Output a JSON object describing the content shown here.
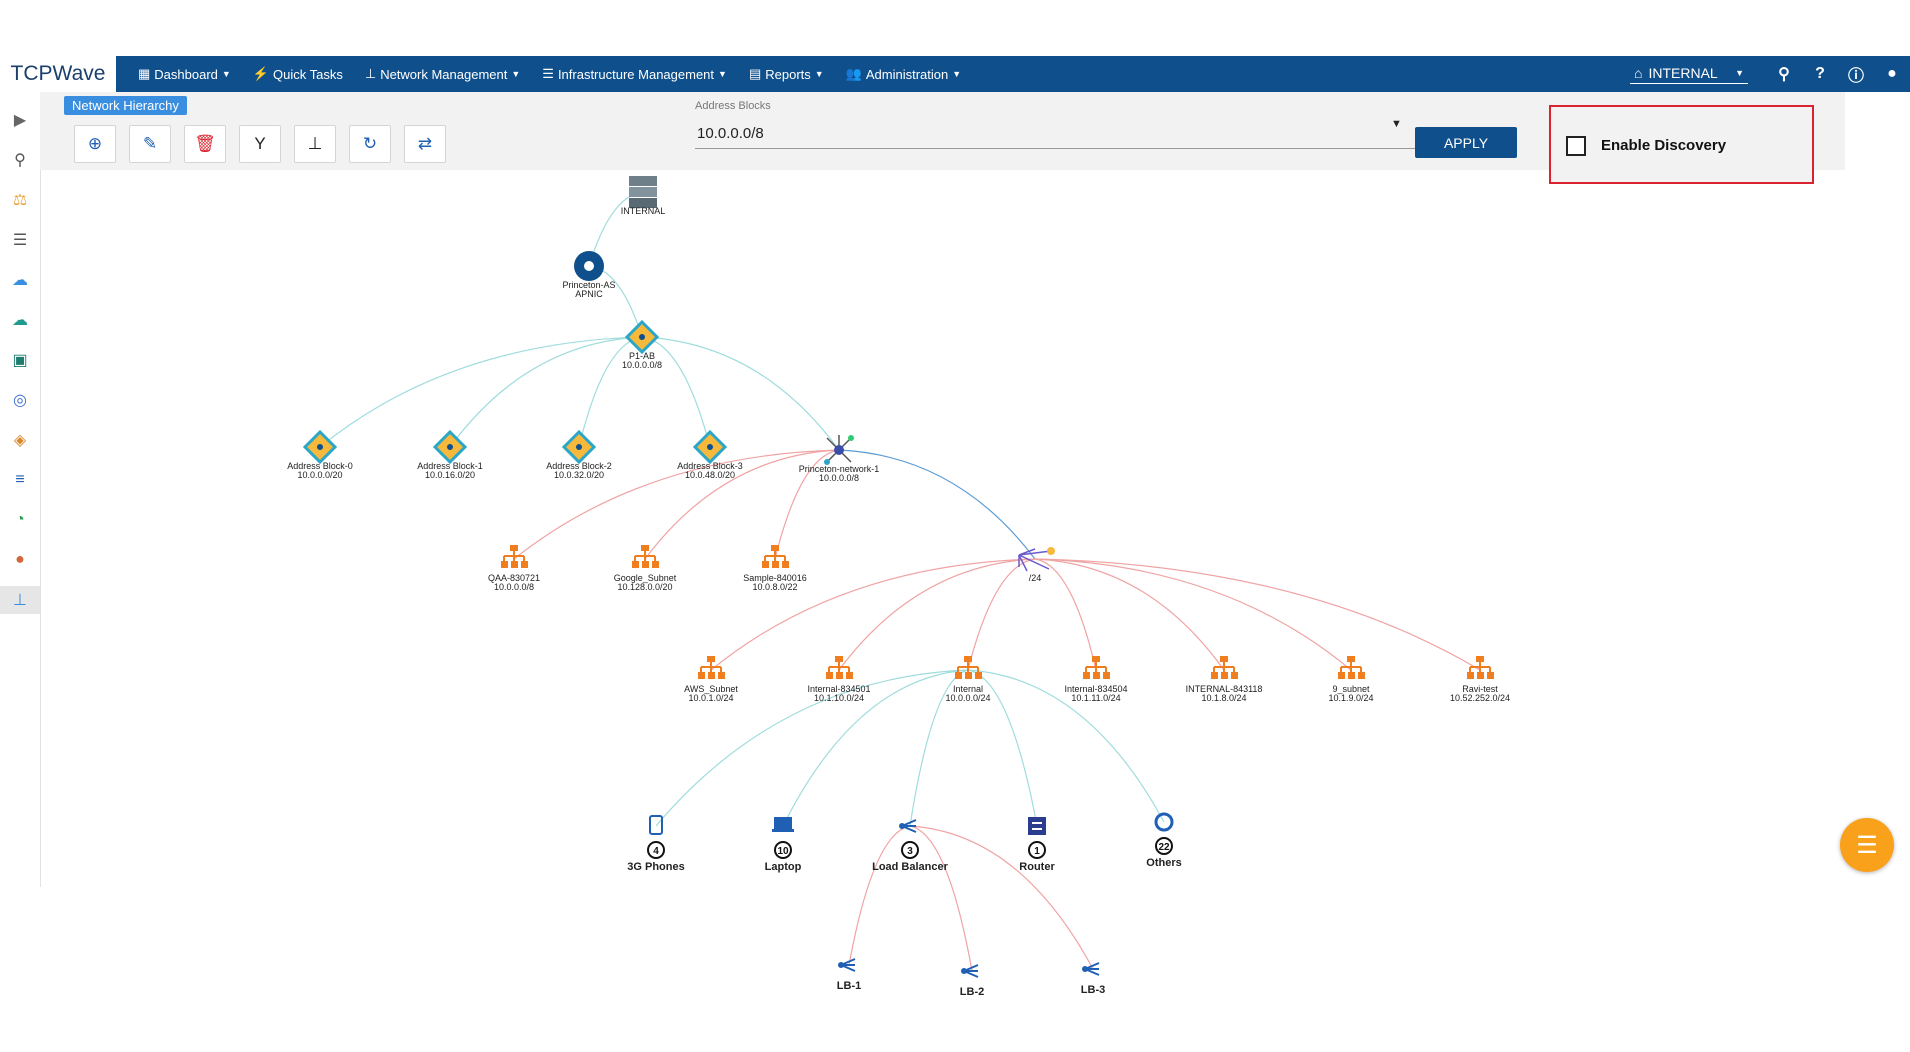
{
  "brand": {
    "logo_text": "TCPWave"
  },
  "nav": {
    "items": [
      {
        "label": "Dashboard",
        "icon": "grid-icon",
        "caret": true
      },
      {
        "label": "Quick Tasks",
        "icon": "wand-icon",
        "caret": false
      },
      {
        "label": "Network Management",
        "icon": "sitemap-icon",
        "caret": true
      },
      {
        "label": "Infrastructure Management",
        "icon": "list-icon",
        "caret": true
      },
      {
        "label": "Reports",
        "icon": "book-icon",
        "caret": true
      },
      {
        "label": "Administration",
        "icon": "users-icon",
        "caret": true
      }
    ],
    "instance": "INTERNAL",
    "right_icons": [
      "search-icon",
      "help-icon",
      "info-icon",
      "user-icon"
    ]
  },
  "sidebar": {
    "icons": [
      "expand-arrow-icon",
      "search-icon",
      "scale-icon",
      "server-stack-icon",
      "cloud-icon",
      "cloud-upload-icon",
      "frame-icon",
      "lifebuoy-icon",
      "box-icon",
      "database-icon",
      "gauge-icon",
      "globe-icon",
      "hierarchy-icon"
    ],
    "active": "hierarchy-icon"
  },
  "toolbar": {
    "title": "Network Hierarchy",
    "buttons": [
      {
        "icon": "add-icon",
        "color": "#1f5fb4"
      },
      {
        "icon": "edit-icon",
        "color": "#1f5fb4"
      },
      {
        "icon": "delete-icon",
        "color": "#d9242f"
      },
      {
        "icon": "filter-icon",
        "color": "#222222"
      },
      {
        "icon": "hierarchy-icon",
        "color": "#222222"
      },
      {
        "icon": "refresh-icon",
        "color": "#1f5fb4"
      },
      {
        "icon": "swap-icon",
        "color": "#1f5fb4"
      }
    ],
    "address_blocks_label": "Address Blocks",
    "address_blocks_value": "10.0.0.0/8",
    "apply_label": "APPLY",
    "enable_discovery_label": "Enable Discovery",
    "enable_discovery_checked": false
  },
  "graph": {
    "nodes": [
      {
        "id": "root",
        "type": "server",
        "lines": [
          "INTERNAL"
        ]
      },
      {
        "id": "as",
        "type": "pin",
        "lines": [
          "Princeton-AS",
          "APNIC"
        ]
      },
      {
        "id": "p1",
        "type": "block",
        "lines": [
          "P1-AB",
          "10.0.0.0/8"
        ]
      },
      {
        "id": "ab0",
        "type": "block",
        "lines": [
          "Address Block-0",
          "10.0.0.0/20"
        ]
      },
      {
        "id": "ab1",
        "type": "block",
        "lines": [
          "Address Block-1",
          "10.0.16.0/20"
        ]
      },
      {
        "id": "ab2",
        "type": "block",
        "lines": [
          "Address Block-2",
          "10.0.32.0/20"
        ]
      },
      {
        "id": "ab3",
        "type": "block",
        "lines": [
          "Address Block-3",
          "10.0.48.0/20"
        ]
      },
      {
        "id": "pn1",
        "type": "network",
        "lines": [
          "Princeton-network-1",
          "10.0.0.0/8"
        ]
      },
      {
        "id": "qaa",
        "type": "subnet",
        "lines": [
          "QAA-830721",
          "10.0.0.0/8"
        ]
      },
      {
        "id": "google",
        "type": "subnet",
        "lines": [
          "Google_Subnet",
          "10.128.0.0/20"
        ]
      },
      {
        "id": "sample",
        "type": "subnet",
        "lines": [
          "Sample-840016",
          "10.0.8.0/22"
        ]
      },
      {
        "id": "s24",
        "type": "mesh",
        "lines": [
          "/24"
        ]
      },
      {
        "id": "aws",
        "type": "subnet",
        "lines": [
          "AWS_Subnet",
          "10.0.1.0/24"
        ]
      },
      {
        "id": "i834501",
        "type": "subnet",
        "lines": [
          "Internal-834501",
          "10.1.10.0/24"
        ]
      },
      {
        "id": "internal",
        "type": "subnet",
        "lines": [
          "Internal",
          "10.0.0.0/24"
        ]
      },
      {
        "id": "i834504",
        "type": "subnet",
        "lines": [
          "Internal-834504",
          "10.1.11.0/24"
        ]
      },
      {
        "id": "i843118",
        "type": "subnet",
        "lines": [
          "INTERNAL-843118",
          "10.1.8.0/24"
        ]
      },
      {
        "id": "s9",
        "type": "subnet",
        "lines": [
          "9_subnet",
          "10.1.9.0/24"
        ]
      },
      {
        "id": "ravi",
        "type": "subnet",
        "lines": [
          "Ravi-test",
          "10.52.252.0/24"
        ]
      },
      {
        "id": "phones",
        "type": "phone",
        "count": "4",
        "lines": [
          "3G Phones"
        ]
      },
      {
        "id": "laptop",
        "type": "laptop",
        "count": "10",
        "lines": [
          "Laptop"
        ]
      },
      {
        "id": "lb",
        "type": "lb",
        "count": "3",
        "lines": [
          "Load Balancer"
        ]
      },
      {
        "id": "router",
        "type": "router",
        "count": "1",
        "lines": [
          "Router"
        ]
      },
      {
        "id": "others",
        "type": "others",
        "count": "22",
        "lines": [
          "Others"
        ]
      },
      {
        "id": "lb1",
        "type": "lb",
        "lines": [
          "LB-1"
        ]
      },
      {
        "id": "lb2",
        "type": "lb",
        "lines": [
          "LB-2"
        ]
      },
      {
        "id": "lb3",
        "type": "lb",
        "lines": [
          "LB-3"
        ]
      }
    ],
    "edges": [
      [
        "root",
        "as"
      ],
      [
        "as",
        "p1"
      ],
      [
        "p1",
        "ab0"
      ],
      [
        "p1",
        "ab1"
      ],
      [
        "p1",
        "ab2"
      ],
      [
        "p1",
        "ab3"
      ],
      [
        "p1",
        "pn1"
      ],
      [
        "pn1",
        "qaa"
      ],
      [
        "pn1",
        "google"
      ],
      [
        "pn1",
        "sample"
      ],
      [
        "pn1",
        "s24"
      ],
      [
        "s24",
        "aws"
      ],
      [
        "s24",
        "i834501"
      ],
      [
        "s24",
        "internal"
      ],
      [
        "s24",
        "i834504"
      ],
      [
        "s24",
        "i843118"
      ],
      [
        "s24",
        "s9"
      ],
      [
        "s24",
        "ravi"
      ],
      [
        "internal",
        "phones"
      ],
      [
        "internal",
        "laptop"
      ],
      [
        "internal",
        "lb"
      ],
      [
        "internal",
        "router"
      ],
      [
        "internal",
        "others"
      ],
      [
        "lb",
        "lb1"
      ],
      [
        "lb",
        "lb2"
      ],
      [
        "lb",
        "lb3"
      ]
    ]
  }
}
